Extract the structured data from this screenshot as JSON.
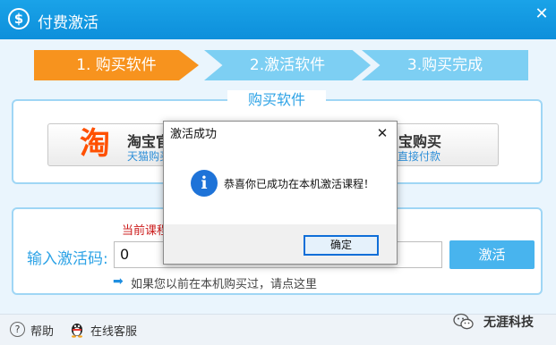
{
  "window": {
    "logo_glyph": "$",
    "title": "付费激活",
    "close_glyph": "✕"
  },
  "steps": [
    {
      "label": "1. 购买软件",
      "state": "active",
      "color": "#f7931e"
    },
    {
      "label": "2.激活软件",
      "state": "inactive",
      "color": "#7dcff3"
    },
    {
      "label": "3.购买完成",
      "state": "inactive",
      "color": "#7dcff3"
    }
  ],
  "buy_section": {
    "title": "购买软件",
    "taobao": {
      "logo_glyph": "淘",
      "title": "淘宝官",
      "subtitle": "天猫购买"
    },
    "alipay": {
      "title": "宝购买",
      "subtitle": "直接付款"
    }
  },
  "activate_section": {
    "current_course_label": "当前课程",
    "code_label": "输入激活码:",
    "code_value": "0",
    "activate_button": "激活",
    "hint_arrow": "➡",
    "hint_text": "如果您以前在本机购买过，请点这里"
  },
  "footer": {
    "help_glyph": "?",
    "help_label": "帮助",
    "support_label": "在线客服",
    "watermark": "无涯科技"
  },
  "dialog": {
    "title": "激活成功",
    "close_glyph": "✕",
    "info_glyph": "i",
    "message": "恭喜你已成功在本机激活课程！",
    "ok_button": "确定"
  },
  "colors": {
    "titlebar": "#0d8fdb",
    "accent": "#2ea3e6",
    "active_step": "#f7931e",
    "inactive_step": "#7dcff3",
    "warning_text": "#cc1d1d",
    "dialog_button_border": "#0f6ed8"
  },
  "icons": {
    "title_logo": "dollar-icon",
    "help": "help-icon",
    "support": "qq-icon",
    "hint": "arrow-right-icon",
    "dialog_info": "info-icon",
    "watermark": "wechat-icon"
  }
}
